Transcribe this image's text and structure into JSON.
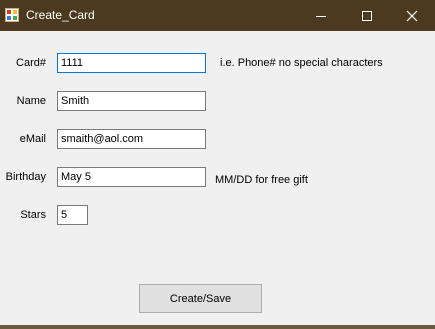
{
  "window": {
    "title": "Create_Card",
    "icon": "app-form-icon",
    "controls": [
      "minimize-icon",
      "maximize-icon",
      "close-icon"
    ]
  },
  "form": {
    "card": {
      "label": "Card#",
      "value": "1111",
      "hint": "i.e. Phone# no special characters"
    },
    "name": {
      "label": "Name",
      "value": "Smith"
    },
    "email": {
      "label": "eMail",
      "value": "smaith@aol.com"
    },
    "birthday": {
      "label": "Birthday",
      "value": "May 5",
      "hint": "MM/DD for free gift"
    },
    "stars": {
      "label": "Stars",
      "value": "5"
    }
  },
  "actions": {
    "create_save_label": "Create/Save"
  },
  "colors": {
    "titlebar": "#4b3a20",
    "client": "#f0f0f0",
    "focus_border": "#0078d7"
  }
}
